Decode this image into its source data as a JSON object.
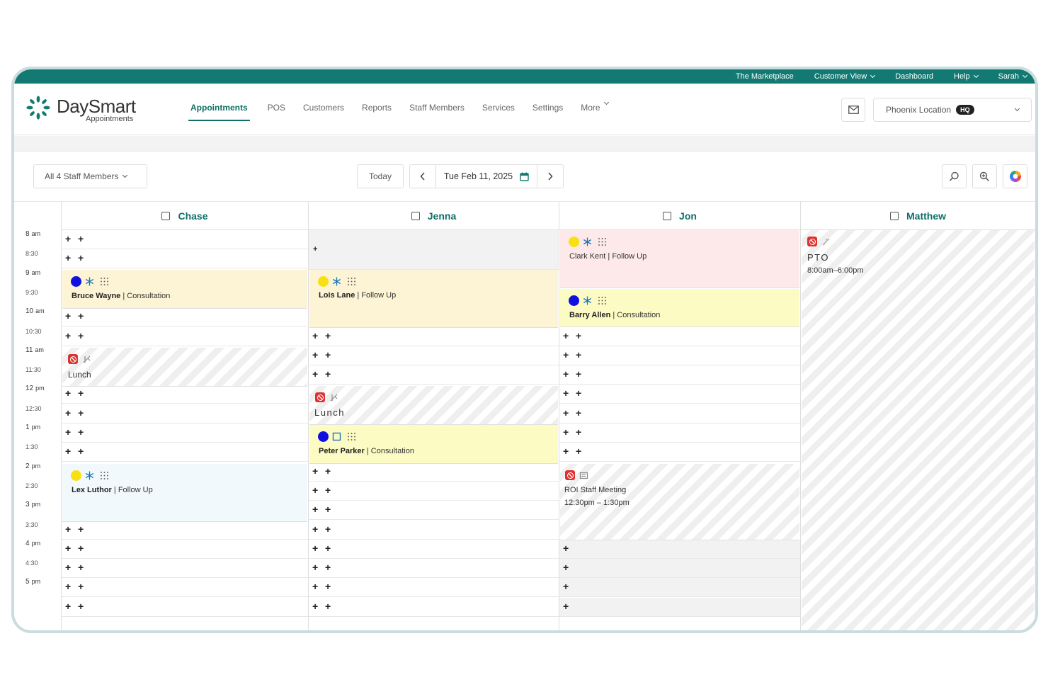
{
  "topbar": {
    "marketplace": "The Marketplace",
    "customer_view": "Customer View",
    "dashboard": "Dashboard",
    "help": "Help",
    "user": "Sarah"
  },
  "brand": {
    "name": "DaySmart",
    "sub": "Appointments",
    "logo_color": "#127a72"
  },
  "nav": {
    "items": [
      "Appointments",
      "POS",
      "Customers",
      "Reports",
      "Staff Members",
      "Services",
      "Settings",
      "More"
    ],
    "active": "Appointments"
  },
  "location": {
    "label": "Phoenix Location",
    "badge": "HQ"
  },
  "toolbar": {
    "staff_filter": "All 4 Staff Members",
    "today": "Today",
    "date": "Tue Feb 11, 2025"
  },
  "times": [
    {
      "label": "8",
      "unit": "am"
    },
    {
      "label": "8:30",
      "unit": ""
    },
    {
      "label": "9",
      "unit": "am"
    },
    {
      "label": "9:30",
      "unit": ""
    },
    {
      "label": "10",
      "unit": "am"
    },
    {
      "label": "10:30",
      "unit": ""
    },
    {
      "label": "11",
      "unit": "am"
    },
    {
      "label": "11:30",
      "unit": ""
    },
    {
      "label": "12",
      "unit": "pm"
    },
    {
      "label": "12:30",
      "unit": ""
    },
    {
      "label": "1",
      "unit": "pm"
    },
    {
      "label": "1:30",
      "unit": ""
    },
    {
      "label": "2",
      "unit": "pm"
    },
    {
      "label": "2:30",
      "unit": ""
    },
    {
      "label": "3",
      "unit": "pm"
    },
    {
      "label": "3:30",
      "unit": ""
    },
    {
      "label": "4",
      "unit": "pm"
    },
    {
      "label": "4:30",
      "unit": ""
    },
    {
      "label": "5",
      "unit": "pm"
    }
  ],
  "staff": {
    "chase": {
      "name": "Chase",
      "bruce": {
        "client": "Bruce Wayne",
        "service": " | Consultation"
      },
      "lunch": "Lunch",
      "lex": {
        "client": "Lex Luthor",
        "service": " | Follow Up"
      }
    },
    "jenna": {
      "name": "Jenna",
      "lois": {
        "client": "Lois Lane",
        "service": " | Follow Up"
      },
      "lunch": "Lunch",
      "peter": {
        "client": "Peter Parker",
        "service": " | Consultation"
      }
    },
    "jon": {
      "name": "Jon",
      "clark": {
        "client": "Clark Kent",
        "service": " | Follow Up"
      },
      "barry": {
        "client": "Barry Allen",
        "service": " | Consultation"
      },
      "meeting": {
        "title": "ROI Staff Meeting",
        "time": "12:30pm – 1:30pm"
      }
    },
    "matthew": {
      "name": "Matthew",
      "pto": {
        "title": "PTO",
        "time": "8:00am–6:00pm"
      }
    }
  },
  "colors": {
    "teal": "#127a72",
    "consult_bg": "#fdfbc4",
    "followup_bg": "#fdf3d5",
    "pink_bg": "#fde9e9",
    "blue_bg": "#f1f9fd",
    "dot_blue": "#1010e0",
    "dot_yellow": "#f8e012",
    "block_red": "#e03030"
  }
}
